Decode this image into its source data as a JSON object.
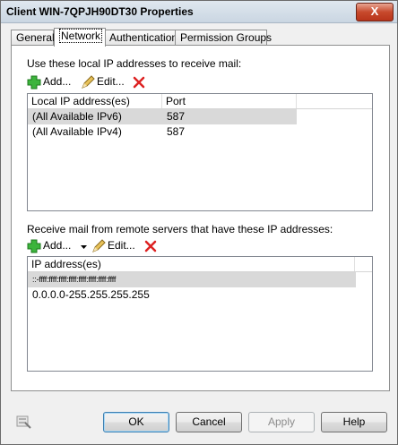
{
  "window": {
    "title": "Client WIN-7QPJH90DT30 Properties",
    "close_glyph": "X"
  },
  "tabs": [
    {
      "label": "General"
    },
    {
      "label": "Network"
    },
    {
      "label": "Authentication"
    },
    {
      "label": "Permission Groups"
    }
  ],
  "local": {
    "heading": "Use these local IP addresses to receive mail:",
    "toolbar": {
      "add": "Add...",
      "edit": "Edit..."
    },
    "columns": [
      "Local IP address(es)",
      "Port"
    ],
    "rows": [
      {
        "address": "(All Available IPv6)",
        "port": "587"
      },
      {
        "address": "(All Available IPv4)",
        "port": "587"
      }
    ]
  },
  "remote": {
    "heading": "Receive mail from remote servers that have these IP addresses:",
    "toolbar": {
      "add": "Add...",
      "edit": "Edit..."
    },
    "columns": [
      "IP address(es)"
    ],
    "rows": [
      {
        "address": "::-ffff:ffff:ffff:ffff:ffff:ffff:ffff:ffff"
      },
      {
        "address": "0.0.0.0-255.255.255.255"
      }
    ]
  },
  "buttons": {
    "ok": "OK",
    "cancel": "Cancel",
    "apply": "Apply",
    "help": "Help"
  },
  "icons": {
    "add": "green-plus-icon",
    "edit": "pencil-icon",
    "remove": "red-x-icon",
    "help_bottom": "properties-icon"
  }
}
